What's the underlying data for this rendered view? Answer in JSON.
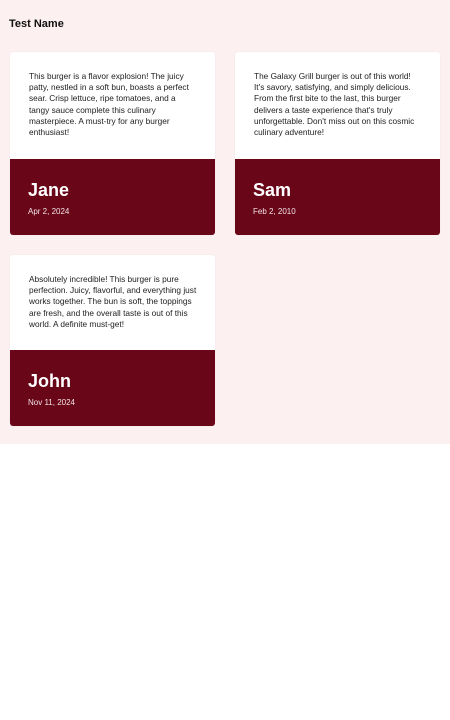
{
  "section": {
    "title": "Test Name"
  },
  "reviews": [
    {
      "text": "This burger is a flavor explosion! The juicy patty, nestled in a soft bun, boasts a perfect sear. Crisp lettuce, ripe tomatoes, and a tangy sauce complete this culinary masterpiece. A must-try for any burger enthusiast!",
      "name": "Jane",
      "date": "Apr 2, 2024"
    },
    {
      "text": "The Galaxy Grill burger is out of this world! It's savory, satisfying, and simply delicious. From the first bite to the last, this burger delivers a taste experience that's truly unforgettable. Don't miss out on this cosmic culinary adventure!",
      "name": "Sam",
      "date": "Feb 2, 2010"
    },
    {
      "text": "Absolutely incredible! This burger is pure perfection. Juicy, flavorful, and everything just works together. The bun is soft, the toppings are fresh, and the overall taste is out of this world. A definite must-get!",
      "name": "John",
      "date": "Nov 11, 2024"
    }
  ],
  "colors": {
    "background": "#fdf0f1",
    "card_footer": "#690618",
    "card": "#ffffff"
  }
}
